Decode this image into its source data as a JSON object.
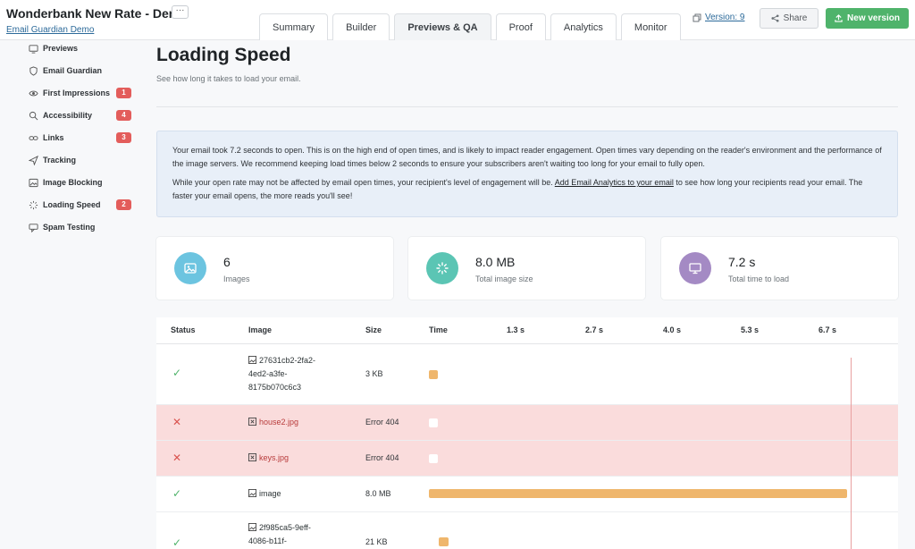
{
  "header": {
    "app_title": "Wonderbank New Rate - Demo",
    "more_label": "···",
    "subtitle": "Email Guardian Demo",
    "tabs": [
      {
        "label": "Summary",
        "active": false
      },
      {
        "label": "Builder",
        "active": false
      },
      {
        "label": "Previews & QA",
        "active": true
      },
      {
        "label": "Proof",
        "active": false
      },
      {
        "label": "Analytics",
        "active": false
      },
      {
        "label": "Monitor",
        "active": false
      }
    ],
    "version_label": "Version: 9",
    "share_label": "Share",
    "new_version_label": "New version",
    "accent_green": "#4fb36b"
  },
  "sidebar": {
    "items": [
      {
        "label": "Previews",
        "icon": "monitor-icon",
        "badge": ""
      },
      {
        "label": "Email Guardian",
        "icon": "shield-icon",
        "badge": ""
      },
      {
        "label": "First Impressions",
        "icon": "eye-icon",
        "badge": "1"
      },
      {
        "label": "Accessibility",
        "icon": "magnifier-icon",
        "badge": "4"
      },
      {
        "label": "Links",
        "icon": "link-icon",
        "badge": "3"
      },
      {
        "label": "Tracking",
        "icon": "send-icon",
        "badge": ""
      },
      {
        "label": "Image Blocking",
        "icon": "image-icon",
        "badge": ""
      },
      {
        "label": "Loading Speed",
        "icon": "spinner-icon",
        "badge": "2"
      },
      {
        "label": "Spam Testing",
        "icon": "spam-icon",
        "badge": ""
      }
    ],
    "badge_color": "#e35d5b"
  },
  "main": {
    "title": "Loading Speed",
    "subtitle": "See how long it takes to load your email.",
    "info": {
      "p1": "Your email took 7.2 seconds to open. This is on the high end of open times, and is likely to impact reader engagement. Open times vary depending on the reader's environment and the performance of the image servers. We recommend keeping load times below 2 seconds to ensure your subscribers aren't waiting too long for your email to fully open.",
      "p2_before": "While your open rate may not be affected by email open times, your recipient's level of engagement will be. ",
      "p2_link": "Add Email Analytics to your email",
      "p2_after": " to see how long your recipients read your email. The faster your email opens, the more reads you'll see!"
    },
    "stats": [
      {
        "value": "6",
        "label": "Images",
        "icon": "image-icon",
        "color": "#6cc4e0"
      },
      {
        "value": "8.0 MB",
        "label": "Total image size",
        "icon": "spinner-icon",
        "color": "#5bc5b4"
      },
      {
        "value": "7.2 s",
        "label": "Total time to load",
        "icon": "monitor-icon",
        "color": "#a48ac4"
      }
    ],
    "table": {
      "headers": {
        "status": "Status",
        "image": "Image",
        "size": "Size",
        "time": "Time"
      },
      "time_ticks": [
        "1.3 s",
        "2.7 s",
        "4.0 s",
        "5.3 s",
        "6.7 s"
      ],
      "rows": [
        {
          "status": "ok",
          "image": "27631cb2-2fa2-4ed2-a3fe-8175b070c6c3",
          "size": "3 KB",
          "bar_start": 0.0,
          "bar_end": 0.15
        },
        {
          "status": "error",
          "image": "house2.jpg",
          "size": "Error 404",
          "bar_start": 0.0,
          "bar_end": 0.15
        },
        {
          "status": "error",
          "image": "keys.jpg",
          "size": "Error 404",
          "bar_start": 0.0,
          "bar_end": 0.15
        },
        {
          "status": "ok",
          "image": "image",
          "size": "8.0 MB",
          "bar_start": 0.0,
          "bar_end": 7.15
        },
        {
          "status": "ok",
          "image": "2f985ca5-9eff-4086-b11f-",
          "size": "21 KB",
          "bar_start": 0.17,
          "bar_end": 0.33
        }
      ],
      "ok_color": "#4fb36b",
      "error_color": "#d9534f"
    }
  }
}
